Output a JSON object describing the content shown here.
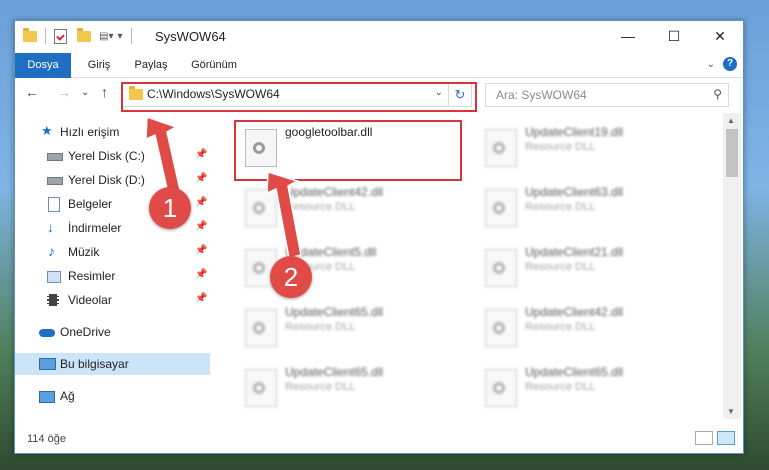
{
  "window": {
    "title": "SysWOW64",
    "minimize": "—",
    "maximize": "☐",
    "close": "✕"
  },
  "ribbon": {
    "tabs": [
      "Dosya",
      "Giriş",
      "Paylaş",
      "Görünüm"
    ]
  },
  "navigation": {
    "back": "←",
    "forward": "→",
    "recent": "⌄",
    "up": "↑",
    "address": "C:\\Windows\\SysWOW64",
    "refresh": "↻",
    "search_placeholder": "Ara: SysWOW64"
  },
  "sidebar": {
    "items": [
      {
        "label": "Hızlı erişim",
        "icon": "star-icon",
        "pinned": false
      },
      {
        "label": "Yerel Disk (C:)",
        "icon": "drive-icon",
        "pinned": true
      },
      {
        "label": "Yerel Disk (D:)",
        "icon": "drive-icon",
        "pinned": true
      },
      {
        "label": "Belgeler",
        "icon": "documents-icon",
        "pinned": true
      },
      {
        "label": "İndirmeler",
        "icon": "download-icon",
        "pinned": true
      },
      {
        "label": "Müzik",
        "icon": "music-icon",
        "pinned": true
      },
      {
        "label": "Resimler",
        "icon": "pictures-icon",
        "pinned": true
      },
      {
        "label": "Videolar",
        "icon": "video-icon",
        "pinned": true
      },
      {
        "label": "OneDrive",
        "icon": "cloud-icon",
        "pinned": false
      },
      {
        "label": "Bu bilgisayar",
        "icon": "computer-icon",
        "pinned": false,
        "selected": true
      },
      {
        "label": "Ağ",
        "icon": "network-icon",
        "pinned": false
      }
    ]
  },
  "files": [
    {
      "name": "googletoolbar.dll",
      "type": "",
      "highlighted": true
    },
    {
      "name": "UpdateClient19.dll",
      "type": "Resource DLL"
    },
    {
      "name": "UpdateClient42.dll",
      "type": "Resource DLL"
    },
    {
      "name": "UpdateClient63.dll",
      "type": "Resource DLL"
    },
    {
      "name": "UpdateClient5.dll",
      "type": "Resource DLL"
    },
    {
      "name": "UpdateClient21.dll",
      "type": "Resource DLL"
    },
    {
      "name": "UpdateClient65.dll",
      "type": "Resource DLL"
    },
    {
      "name": "UpdateClient42.dll",
      "type": "Resource DLL"
    },
    {
      "name": "UpdateClient65.dll",
      "type": "Resource DLL"
    },
    {
      "name": "UpdateClient65.dll",
      "type": "Resource DLL"
    }
  ],
  "status": {
    "count": "114 öğe"
  },
  "annotations": {
    "step1": "1",
    "step2": "2",
    "color": "#d9343a"
  }
}
